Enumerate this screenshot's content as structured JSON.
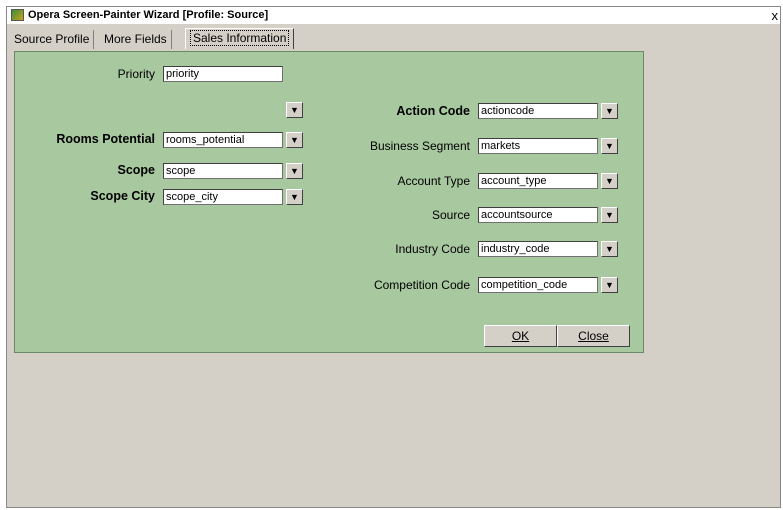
{
  "window": {
    "title": "Opera Screen-Painter Wizard [Profile: Source]",
    "close_glyph": "x"
  },
  "tabs": [
    {
      "label": "Source Profile"
    },
    {
      "label": "More Fields"
    },
    {
      "label": "Sales Information"
    }
  ],
  "left_fields": {
    "priority": {
      "label": "Priority",
      "value": "priority"
    },
    "rooms_potential": {
      "label": "Rooms Potential",
      "value": "rooms_potential"
    },
    "scope": {
      "label": "Scope",
      "value": "scope"
    },
    "scope_city": {
      "label": "Scope City",
      "value": "scope_city"
    }
  },
  "right_fields": {
    "action_code": {
      "label": "Action Code",
      "value": "actioncode"
    },
    "business_segment": {
      "label": "Business Segment",
      "value": "markets"
    },
    "account_type": {
      "label": "Account Type",
      "value": "account_type"
    },
    "source": {
      "label": "Source",
      "value": "accountsource"
    },
    "industry_code": {
      "label": "Industry Code",
      "value": "industry_code"
    },
    "competition_code": {
      "label": "Competition Code",
      "value": "competition_code"
    }
  },
  "buttons": {
    "ok": "OK",
    "close": "Close"
  },
  "icons": {
    "dropdown": "down-arrow-icon",
    "app": "opera-app-icon"
  },
  "colors": {
    "panel": "#a8c8a0",
    "window": "#d4d0c8"
  }
}
